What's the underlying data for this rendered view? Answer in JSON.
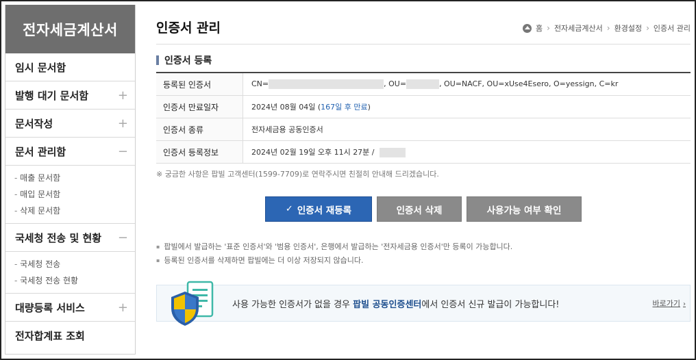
{
  "sidebar": {
    "title": "전자세금계산서",
    "items": [
      {
        "label": "임시 문서함",
        "sign": ""
      },
      {
        "label": "발행 대기 문서함",
        "sign": "+"
      },
      {
        "label": "문서작성",
        "sign": "+"
      },
      {
        "label": "문서 관리함",
        "sign": "−"
      }
    ],
    "doc_sub": [
      "매출 문서함",
      "매입 문서함",
      "삭제 문서함"
    ],
    "nts": {
      "label": "국세청 전송 및 현황",
      "sign": "−"
    },
    "nts_sub": [
      "국세청 전송",
      "국세청 전송 현황"
    ],
    "bulk": {
      "label": "대량등록 서비스",
      "sign": "+"
    },
    "total": {
      "label": "전자합계표 조회"
    }
  },
  "header": {
    "title": "인증서 관리",
    "breadcrumb": [
      "홈",
      "전자세금계산서",
      "환경설정",
      "인증서 관리"
    ]
  },
  "section": {
    "title": "인증서 등록"
  },
  "table": {
    "rows": [
      {
        "label": "등록된 인증서",
        "val_a": "CN=",
        "val_b": ", OU=",
        "val_c": ", OU=NACF, OU=xUse4Esero, O=yessign, C=kr"
      },
      {
        "label": "인증서 만료일자",
        "date": "2024년 08월 04일 (",
        "days": "167일 후 만료",
        "tail": ")"
      },
      {
        "label": "인증서 종류",
        "value": "전자세금용 공동인증서"
      },
      {
        "label": "인증서 등록정보",
        "value": "2024년 02월 19일 오후 11시 27분 /"
      }
    ]
  },
  "help_text": "※ 궁금한 사항은 팝빌 고객센터(1599-7709)로 연락주시면 친절히 안내해 드리겠습니다.",
  "buttons": {
    "reregister": "인증서 재등록",
    "delete": "인증서 삭제",
    "check": "사용가능 여부 확인"
  },
  "notes": [
    "팝빌에서 발급하는 '표준 인증서'와 '범용 인증서', 은행에서 발급하는 '전자세금용 인증서'만 등록이 가능합니다.",
    "등록된 인증서를 삭제하면 팝빌에는 더 이상 저장되지 않습니다."
  ],
  "banner": {
    "pre": "사용 가능한 인증서가 없을 경우 ",
    "highlight": "팝빌 공동인증센터",
    "post": "에서 인증서 신규 발급이 가능합니다!",
    "link": "바로가기"
  },
  "colors": {
    "primary": "#2c66b4",
    "gray_button": "#8a8a8a",
    "sidebar_head": "#6e6e6e",
    "days_highlight": "#2161b0"
  }
}
